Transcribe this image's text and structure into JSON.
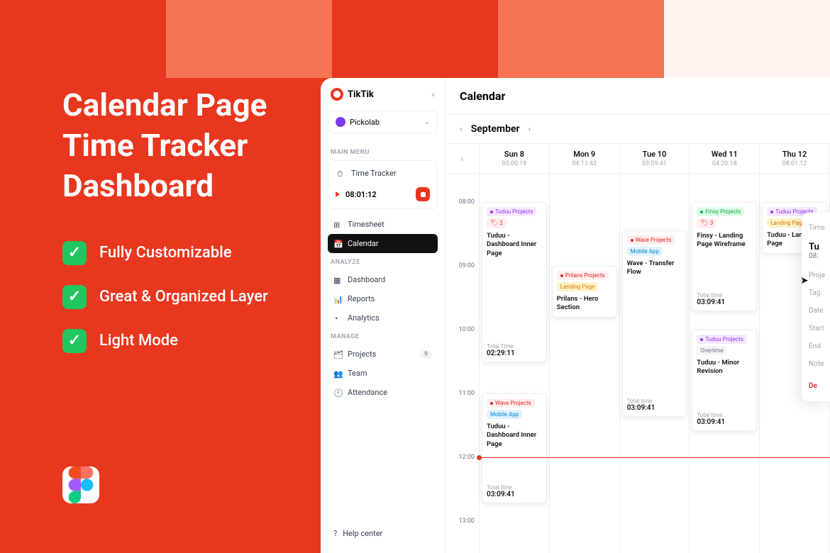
{
  "hero": {
    "title_l1": "Calendar Page",
    "title_l2": "Time Tracker",
    "title_l3": "Dashboard",
    "features": [
      "Fully Customizable",
      "Great & Organized Layer",
      "Light Mode"
    ]
  },
  "app_name": "TikTik",
  "workspace": "Pickolab",
  "sections": {
    "main_menu": "MAIN MENU",
    "analyze": "ANALYZE",
    "manage": "MANAGE"
  },
  "nav": {
    "time_tracker": "Time Tracker",
    "timer_value": "08:01:12",
    "timesheet": "Timesheet",
    "calendar": "Calendar",
    "dashboard": "Dashboard",
    "reports": "Reports",
    "analytics": "Analytics",
    "projects": "Projects",
    "projects_count": "9",
    "team": "Team",
    "attendance": "Attendance",
    "help": "Help center"
  },
  "page_title": "Calendar",
  "month": "September",
  "days": [
    {
      "name": "Sun 8",
      "time": "05:00:19"
    },
    {
      "name": "Mon 9",
      "time": "04:11:42"
    },
    {
      "name": "Tue 10",
      "time": "03:09:41"
    },
    {
      "name": "Wed 11",
      "time": "04:20:18"
    },
    {
      "name": "Thu 12",
      "time": "08:01:12"
    }
  ],
  "hours": [
    "08:00",
    "09:00",
    "10:00",
    "11:00",
    "12:00",
    "13:00"
  ],
  "events": {
    "sun1": {
      "proj": "Tuduu Projects",
      "tag": "2",
      "title": "Tuduu - Dashboard Inner Page",
      "total_l": "Total Time",
      "total": "02:29:11"
    },
    "sun2": {
      "proj": "Wave Projects",
      "tag": "Mobile App",
      "title": "Tuduu - Dashboard Inner Page",
      "total_l": "Total time",
      "total": "03:09:41"
    },
    "mon1": {
      "proj": "Prilans Projects",
      "tag": "Landing Page",
      "title": "Prilans - Hero Section"
    },
    "tue1": {
      "proj": "Wave Projects",
      "tag": "Mobile App",
      "title": "Wave - Transfer Flow",
      "total_l": "Total time",
      "total": "03:09:41"
    },
    "wed1": {
      "proj": "Finsy Projects",
      "tag": "3",
      "title": "Finsy - Landing Page Wireframe",
      "total_l": "Total time",
      "total": "03:09:41"
    },
    "wed2": {
      "proj": "Tuduu Projects",
      "tag": "Overtime",
      "title": "Tuduu - Minor Revision",
      "total_l": "Total time",
      "total": "03:09:41"
    },
    "thu1": {
      "proj": "Tuduu Projects",
      "tag": "Landing Page",
      "title": "Tuduu - Landing Page"
    }
  },
  "popup": {
    "header": "Time",
    "title_prefix": "Tu",
    "time_prefix": "08:",
    "rows": [
      "Proje",
      "Tag",
      "Date",
      "Start",
      "End",
      "Note"
    ],
    "delete": "De"
  }
}
